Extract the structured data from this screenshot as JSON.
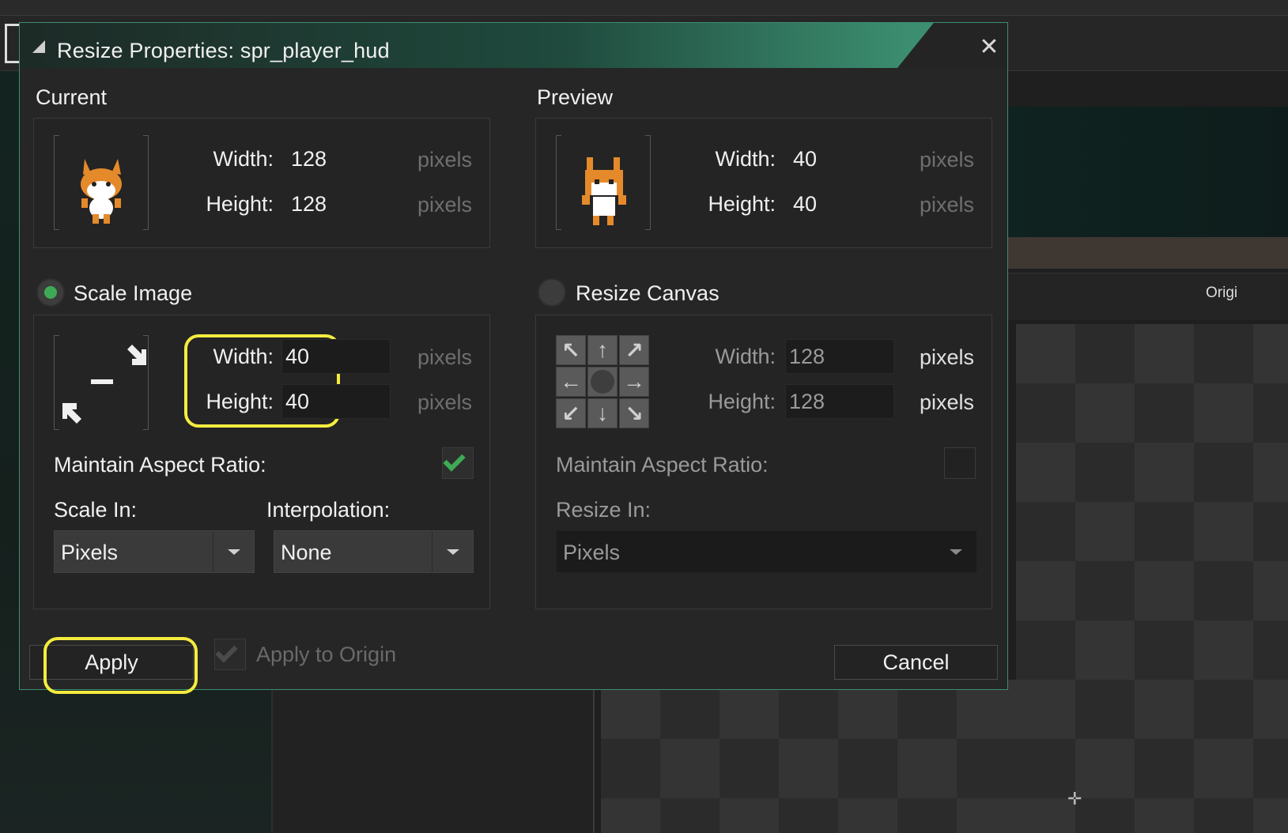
{
  "background": {
    "origin_label": "Origi"
  },
  "dialog": {
    "title": "Resize Properties: spr_player_hud",
    "current": {
      "label": "Current",
      "width_label": "Width:",
      "width_value": "128",
      "width_unit": "pixels",
      "height_label": "Height:",
      "height_value": "128",
      "height_unit": "pixels"
    },
    "preview": {
      "label": "Preview",
      "width_label": "Width:",
      "width_value": "40",
      "width_unit": "pixels",
      "height_label": "Height:",
      "height_value": "40",
      "height_unit": "pixels"
    },
    "scale_image": {
      "label": "Scale Image",
      "selected": true,
      "width_label": "Width:",
      "width_value": "40",
      "width_unit": "pixels",
      "height_label": "Height:",
      "height_value": "40",
      "height_unit": "pixels",
      "maintain_aspect_label": "Maintain Aspect Ratio:",
      "maintain_aspect_checked": true,
      "scale_in_label": "Scale In:",
      "scale_in_value": "Pixels",
      "interpolation_label": "Interpolation:",
      "interpolation_value": "None"
    },
    "resize_canvas": {
      "label": "Resize Canvas",
      "selected": false,
      "width_label": "Width:",
      "width_value": "128",
      "width_unit": "pixels",
      "height_label": "Height:",
      "height_value": "128",
      "height_unit": "pixels",
      "maintain_aspect_label": "Maintain Aspect Ratio:",
      "maintain_aspect_checked": false,
      "resize_in_label": "Resize In:",
      "resize_in_value": "Pixels"
    },
    "buttons": {
      "apply": "Apply",
      "apply_to_origin": "Apply to Origin",
      "cancel": "Cancel"
    }
  },
  "colors": {
    "accent": "#3c8e70",
    "highlight": "#f3ec3f",
    "check": "#3faa55"
  }
}
